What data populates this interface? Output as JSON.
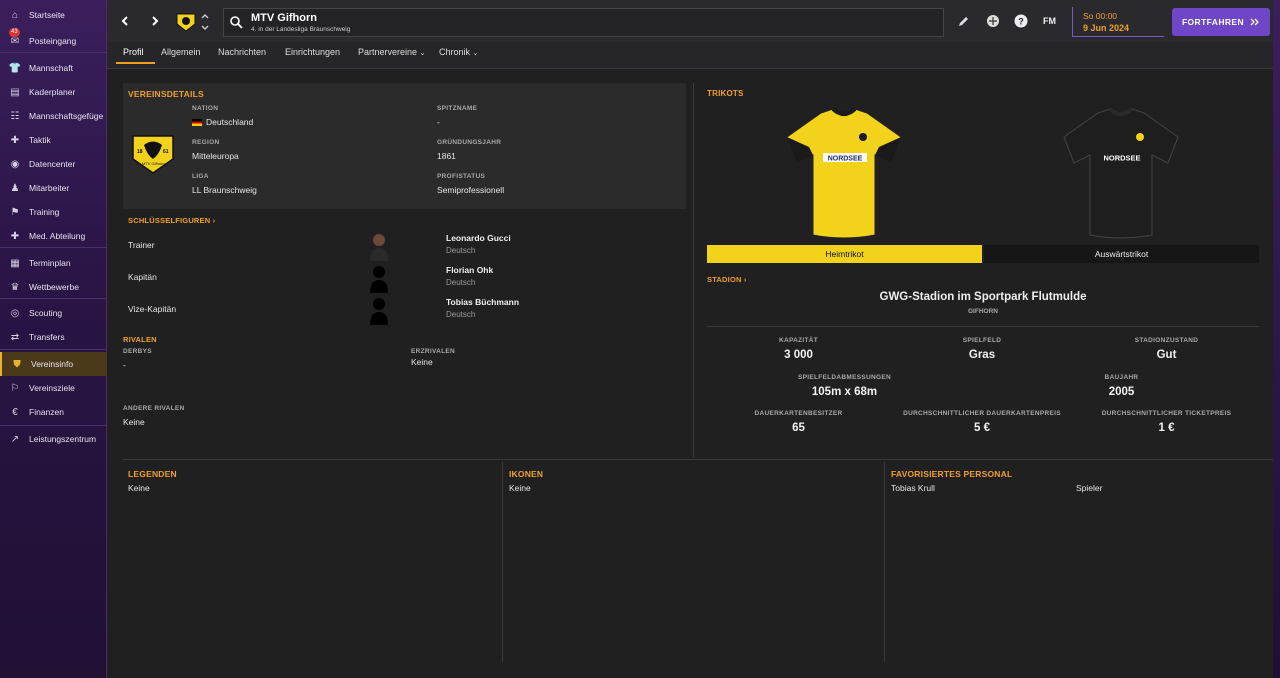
{
  "sidebar": {
    "items": [
      {
        "label": "Startseite",
        "icon": "home-icon"
      },
      {
        "label": "Posteingang",
        "icon": "inbox-icon",
        "badge": "43"
      },
      {
        "label": "Mannschaft",
        "icon": "shirt-icon"
      },
      {
        "label": "Kaderplaner",
        "icon": "clipboard-icon"
      },
      {
        "label": "Mannschaftsgefüge",
        "icon": "people-icon"
      },
      {
        "label": "Taktik",
        "icon": "tactics-icon"
      },
      {
        "label": "Datencenter",
        "icon": "data-icon"
      },
      {
        "label": "Mitarbeiter",
        "icon": "staff-icon"
      },
      {
        "label": "Training",
        "icon": "training-icon"
      },
      {
        "label": "Med. Abteilung",
        "icon": "medical-icon"
      },
      {
        "label": "Terminplan",
        "icon": "calendar-icon"
      },
      {
        "label": "Wettbewerbe",
        "icon": "trophy-icon"
      },
      {
        "label": "Scouting",
        "icon": "scouting-icon"
      },
      {
        "label": "Transfers",
        "icon": "transfer-icon"
      },
      {
        "label": "Vereinsinfo",
        "icon": "shield-icon"
      },
      {
        "label": "Vereinsziele",
        "icon": "goals-icon"
      },
      {
        "label": "Finanzen",
        "icon": "finance-icon"
      },
      {
        "label": "Leistungszentrum",
        "icon": "performance-icon"
      }
    ]
  },
  "header": {
    "club_name": "MTV Gifhorn",
    "club_sub": "4. in der Landesliga Braunschweig",
    "fm_label": "FM",
    "date_day": "So 00:00",
    "date_full": "9 Jun 2024",
    "continue_label": "FORTFAHREN"
  },
  "tabs": [
    "Profil",
    "Allgemein",
    "Nachrichten",
    "Einrichtungen",
    "Partnervereine",
    "Chronik"
  ],
  "details": {
    "title": "VEREINSDETAILS",
    "nation_label": "NATION",
    "nation": "Deutschland",
    "region_label": "REGION",
    "region": "Mitteleuropa",
    "league_label": "LIGA",
    "league": "LL Braunschweig",
    "nickname_label": "SPITZNAME",
    "nickname": "-",
    "founded_label": "GRÜNDUNGSJAHR",
    "founded": "1861",
    "status_label": "PROFISTATUS",
    "status": "Semiprofessionell",
    "crest_years_left": "18",
    "crest_years_right": "61",
    "crest_text": "MTV Gifhorn"
  },
  "key_people": {
    "title": "SCHLÜSSELFIGUREN",
    "rows": [
      {
        "role": "Trainer",
        "name": "Leonardo Gucci",
        "nationality": "Deutsch"
      },
      {
        "role": "Kapitän",
        "name": "Florian Ohk",
        "nationality": "Deutsch"
      },
      {
        "role": "Vize-Kapitän",
        "name": "Tobias Büchmann",
        "nationality": "Deutsch"
      }
    ]
  },
  "rivals": {
    "title": "RIVALEN",
    "derbys_label": "DERBYS",
    "derbys": "-",
    "arch_label": "ERZRIVALEN",
    "arch": "Keine",
    "other_label": "ANDERE RIVALEN",
    "other": "Keine"
  },
  "kits": {
    "title": "TRIKOTS",
    "home_label": "Heimtrikot",
    "away_label": "Auswärtstrikot",
    "sponsor": "NORDSEE",
    "home_color": "#f2d21b",
    "away_color": "#1a1a1a"
  },
  "stadium": {
    "title": "STADION",
    "name": "GWG-Stadion im Sportpark Flutmulde",
    "city": "GIFHORN",
    "capacity_label": "KAPAZITÄT",
    "capacity": "3 000",
    "surface_label": "SPIELFELD",
    "surface": "Gras",
    "condition_label": "STADIONZUSTAND",
    "condition": "Gut",
    "dimensions_label": "SPIELFELDABMESSUNGEN",
    "dimensions": "105m x 68m",
    "built_label": "BAUJAHR",
    "built": "2005",
    "season_holders_label": "DAUERKARTENBESITZER",
    "season_holders": "65",
    "season_price_label": "DURCHSCHNITTLICHER DAUERKARTENPREIS",
    "season_price": "5 €",
    "ticket_price_label": "DURCHSCHNITTLICHER TICKETPREIS",
    "ticket_price": "1 €"
  },
  "bottom": {
    "legends_title": "LEGENDEN",
    "legends": "Keine",
    "icons_title": "IKONEN",
    "icons": "Keine",
    "fav_title": "FAVORISIERTES PERSONAL",
    "fav_name": "Tobias Krull",
    "fav_role": "Spieler"
  },
  "colors": {
    "accent": "#f0a020",
    "continue": "#7a4fd0",
    "kit_yellow": "#f2d21b"
  }
}
